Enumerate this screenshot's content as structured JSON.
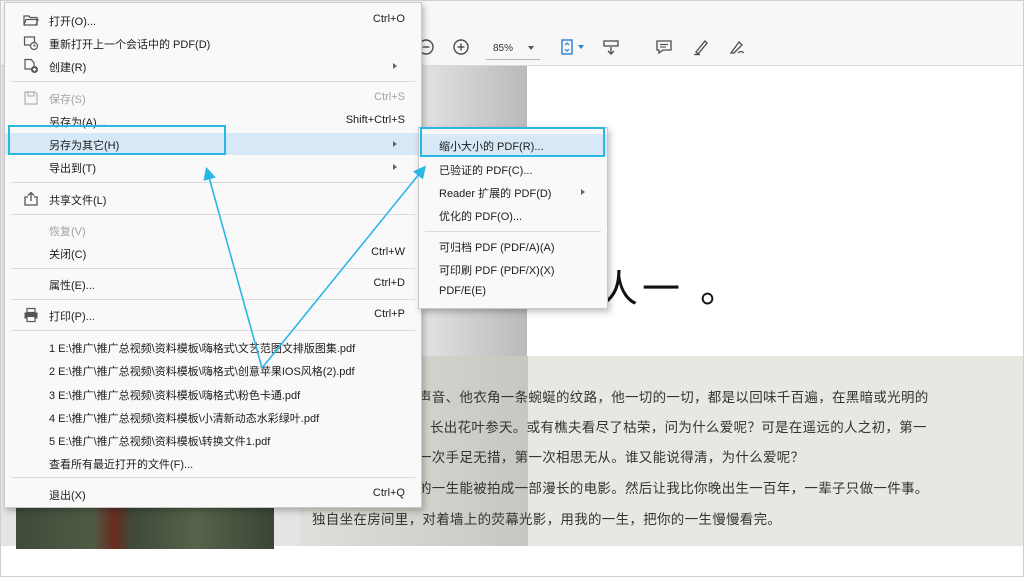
{
  "toolbar": {
    "zoom": "85%",
    "icons": [
      "zoom-out-icon",
      "zoom-in-icon",
      "page-fit-icon",
      "scroll-mode-icon",
      "comment-icon",
      "highlight-pen-icon",
      "sign-icon"
    ]
  },
  "file_menu": {
    "items": [
      {
        "label": "打开(O)...",
        "shortcut": "Ctrl+O",
        "icon": "folder-open-icon",
        "enabled": true
      },
      {
        "label": "重新打开上一个会话中的 PDF(D)",
        "shortcut": "",
        "icon": "reopen-session-icon",
        "enabled": true
      },
      {
        "label": "创建(R)",
        "shortcut": "",
        "icon": "create-pdf-icon",
        "enabled": true,
        "submenu": true
      },
      {
        "label": "保存(S)",
        "shortcut": "Ctrl+S",
        "icon": "save-icon",
        "enabled": false
      },
      {
        "label": "另存为(A)...",
        "shortcut": "Shift+Ctrl+S",
        "icon": "",
        "enabled": true
      },
      {
        "label": "另存为其它(H)",
        "shortcut": "",
        "icon": "",
        "enabled": true,
        "submenu": true,
        "highlighted": true
      },
      {
        "label": "导出到(T)",
        "shortcut": "",
        "icon": "",
        "enabled": true,
        "submenu": true
      },
      {
        "label": "共享文件(L)",
        "shortcut": "",
        "icon": "share-icon",
        "enabled": true
      },
      {
        "label": "恢复(V)",
        "shortcut": "",
        "icon": "",
        "enabled": false
      },
      {
        "label": "关闭(C)",
        "shortcut": "Ctrl+W",
        "icon": "",
        "enabled": true
      },
      {
        "label": "属性(E)...",
        "shortcut": "Ctrl+D",
        "icon": "",
        "enabled": true
      },
      {
        "label": "打印(P)...",
        "shortcut": "Ctrl+P",
        "icon": "printer-icon",
        "enabled": true
      },
      {
        "label": "1 E:\\推广\\推广总视频\\资料模板\\嗨格式\\文艺范图文排版图集.pdf",
        "shortcut": "",
        "icon": "",
        "enabled": true
      },
      {
        "label": "2 E:\\推广\\推广总视频\\资料模板\\嗨格式\\创意苹果IOS风格(2).pdf",
        "shortcut": "",
        "icon": "",
        "enabled": true
      },
      {
        "label": "3 E:\\推广\\推广总视频\\资料模板\\嗨格式\\粉色卡通.pdf",
        "shortcut": "",
        "icon": "",
        "enabled": true
      },
      {
        "label": "4 E:\\推广\\推广总视频\\资料模板\\小清新动态水彩绿叶.pdf",
        "shortcut": "",
        "icon": "",
        "enabled": true
      },
      {
        "label": "5 E:\\推广\\推广总视频\\资料模板\\转换文件1.pdf",
        "shortcut": "",
        "icon": "",
        "enabled": true
      },
      {
        "label": "查看所有最近打开的文件(F)...",
        "shortcut": "",
        "icon": "",
        "enabled": true
      },
      {
        "label": "退出(X)",
        "shortcut": "Ctrl+Q",
        "icon": "",
        "enabled": true
      }
    ]
  },
  "sub_menu": {
    "items": [
      {
        "label": "缩小大小的 PDF(R)...",
        "submenu": false,
        "highlighted": true
      },
      {
        "label": "已验证的 PDF(C)...",
        "submenu": false
      },
      {
        "label": "Reader 扩展的 PDF(D)",
        "submenu": true
      },
      {
        "label": "优化的 PDF(O)...",
        "submenu": false
      },
      {
        "label": "可归档 PDF (PDF/A)(A)",
        "submenu": false
      },
      {
        "label": "可印刷 PDF (PDF/X)(X)",
        "submenu": false
      },
      {
        "label": "PDF/E(E)",
        "submenu": false
      }
    ]
  },
  "document": {
    "heading_fragment": "人一 。",
    "paragraph_lines": [
      "声音、他衣角一条蜿蜒的纹路，他一切的一切，都是以回味千百遍，在黑暗或光明的",
      "长出花叶参天。或有樵夫看尽了枯荣，问为什么爱呢？可是在遥远的人之初，第一",
      "一次手足无措，第一次相思无从。谁又能说得清，为什么爱呢？",
      "的一生能被拍成一部漫长的电影。然后让我比你晚出生一百年，一辈子只做一件事。",
      "独自坐在房间里，对着墙上的荧幕光影，用我的一生，把你的一生慢慢看完。"
    ]
  },
  "colors": {
    "callout": "#2bb7e5",
    "menu_highlight": "#d7e8f6",
    "disabled_text": "#a3a3a3"
  }
}
